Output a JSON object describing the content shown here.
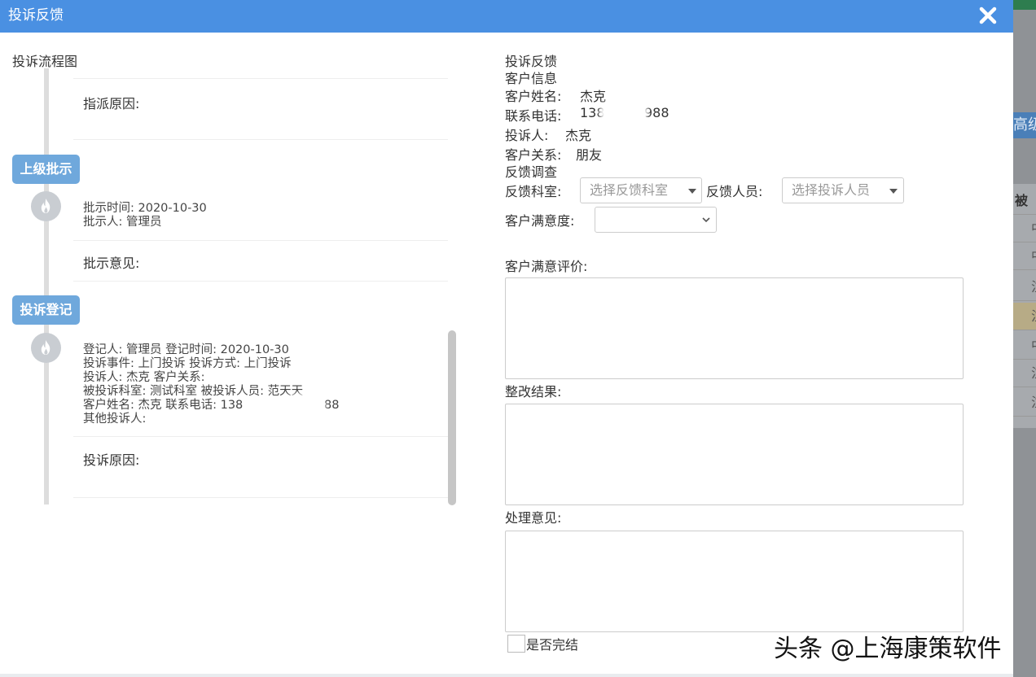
{
  "modal": {
    "title": "投诉反馈"
  },
  "flow": {
    "title": "投诉流程图",
    "dispatch_card": {
      "reason_label": "指派原因:"
    },
    "stage_superior": {
      "tag": "上级批示",
      "time_line": "批示时间: 2020-10-30",
      "person_line": "批示人:  管理员",
      "opinion_label": "批示意见:"
    },
    "stage_register": {
      "tag": "投诉登记",
      "lines": [
        "登记人:  管理员 登记时间:  2020-10-30",
        "投诉事件:  上门投诉 投诉方式:  上门投诉",
        "投诉人:  杰克 客户关系:",
        "被投诉科室:  测试科室 被投诉人员:  范天天",
        "客户姓名:  杰克 联系电话:  138",
        "其他投诉人:"
      ],
      "phone_tail": "88",
      "reason_label": "投诉原因:"
    }
  },
  "form": {
    "section_title": "投诉反馈",
    "customer_info_title": "客户信息",
    "customer_name_label": "客户姓名:",
    "customer_name": "杰克",
    "phone_label": "联系电话:",
    "phone_prefix": "138",
    "phone_suffix": "988",
    "complainant_label": "投诉人:",
    "complainant": "杰克",
    "relation_label": "客户关系:",
    "relation": "朋友",
    "survey_title": "反馈调查",
    "dept_label": "反馈科室:",
    "dept_placeholder": "选择反馈科室",
    "staff_label": "反馈人员:",
    "staff_placeholder": "选择投诉人员",
    "satisfaction_label": "客户满意度:",
    "satisfaction_value": "",
    "evaluation_label": "客户满意评价:",
    "rectify_label": "整改结果:",
    "handling_label": "处理意见:",
    "done_label": "是否完结"
  },
  "background": {
    "button_text": "高级",
    "column_header": "被",
    "row_texts": [
      "中",
      "中",
      "注",
      "注",
      "中",
      "注",
      "注"
    ]
  },
  "watermark": "头条 @上海康策软件",
  "colors": {
    "header_bg": "#4a90e2",
    "stage_tag_bg": "#6fa8dc",
    "node_bg": "#c9cdd2",
    "timeline": "#dddddd"
  },
  "icons": {
    "close": "close-icon",
    "node": "flame-icon",
    "dropdown": "caret-down-icon"
  }
}
